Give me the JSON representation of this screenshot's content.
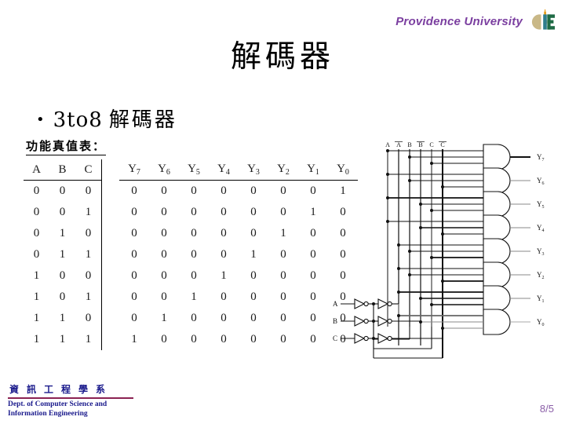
{
  "header": {
    "university": "Providence University",
    "logo_alt": "providence-university-logo",
    "logo_colors": {
      "c_crescent": "#c9b887",
      "i_letter": "#2e7d8c",
      "e_letter": "#1f6b45",
      "flame": "#e8a020"
    }
  },
  "title": "解碼器",
  "bullet": {
    "marker": "•",
    "latin": "3to8",
    "cjk": "解碼器"
  },
  "subcaption": "功能真值表：",
  "table": {
    "input_headers": [
      "A",
      "B",
      "C"
    ],
    "output_headers": [
      {
        "base": "Y",
        "sub": "7"
      },
      {
        "base": "Y",
        "sub": "6"
      },
      {
        "base": "Y",
        "sub": "5"
      },
      {
        "base": "Y",
        "sub": "4"
      },
      {
        "base": "Y",
        "sub": "3"
      },
      {
        "base": "Y",
        "sub": "2"
      },
      {
        "base": "Y",
        "sub": "1"
      },
      {
        "base": "Y",
        "sub": "0"
      }
    ],
    "rows": [
      {
        "inputs": [
          "0",
          "0",
          "0"
        ],
        "outputs": [
          "0",
          "0",
          "0",
          "0",
          "0",
          "0",
          "0",
          "1"
        ]
      },
      {
        "inputs": [
          "0",
          "0",
          "1"
        ],
        "outputs": [
          "0",
          "0",
          "0",
          "0",
          "0",
          "0",
          "1",
          "0"
        ]
      },
      {
        "inputs": [
          "0",
          "1",
          "0"
        ],
        "outputs": [
          "0",
          "0",
          "0",
          "0",
          "0",
          "1",
          "0",
          "0"
        ]
      },
      {
        "inputs": [
          "0",
          "1",
          "1"
        ],
        "outputs": [
          "0",
          "0",
          "0",
          "0",
          "1",
          "0",
          "0",
          "0"
        ]
      },
      {
        "inputs": [
          "1",
          "0",
          "0"
        ],
        "outputs": [
          "0",
          "0",
          "0",
          "1",
          "0",
          "0",
          "0",
          "0"
        ]
      },
      {
        "inputs": [
          "1",
          "0",
          "1"
        ],
        "outputs": [
          "0",
          "0",
          "1",
          "0",
          "0",
          "0",
          "0",
          "0"
        ]
      },
      {
        "inputs": [
          "1",
          "1",
          "0"
        ],
        "outputs": [
          "0",
          "1",
          "0",
          "0",
          "0",
          "0",
          "0",
          "0"
        ]
      },
      {
        "inputs": [
          "1",
          "1",
          "1"
        ],
        "outputs": [
          "1",
          "0",
          "0",
          "0",
          "0",
          "0",
          "0",
          "0"
        ]
      }
    ]
  },
  "circuit": {
    "rail_labels": [
      "A",
      "A̅",
      "B",
      "B̅",
      "C",
      "C̅"
    ],
    "input_labels": [
      "A",
      "B",
      "C"
    ],
    "output_labels": [
      "Y7",
      "Y6",
      "Y5",
      "Y4",
      "Y3",
      "Y2",
      "Y1",
      "Y0"
    ],
    "gate_type": "AND",
    "inverter_stages_per_input": 2
  },
  "footer": {
    "dept_cjk": "資訊工程學系",
    "dept_en_line1": "Dept. of Computer Science and",
    "dept_en_line2": "Information Engineering",
    "rule_color": "#8b2252",
    "text_color": "#1a1a8c"
  },
  "page_number": "8/5"
}
